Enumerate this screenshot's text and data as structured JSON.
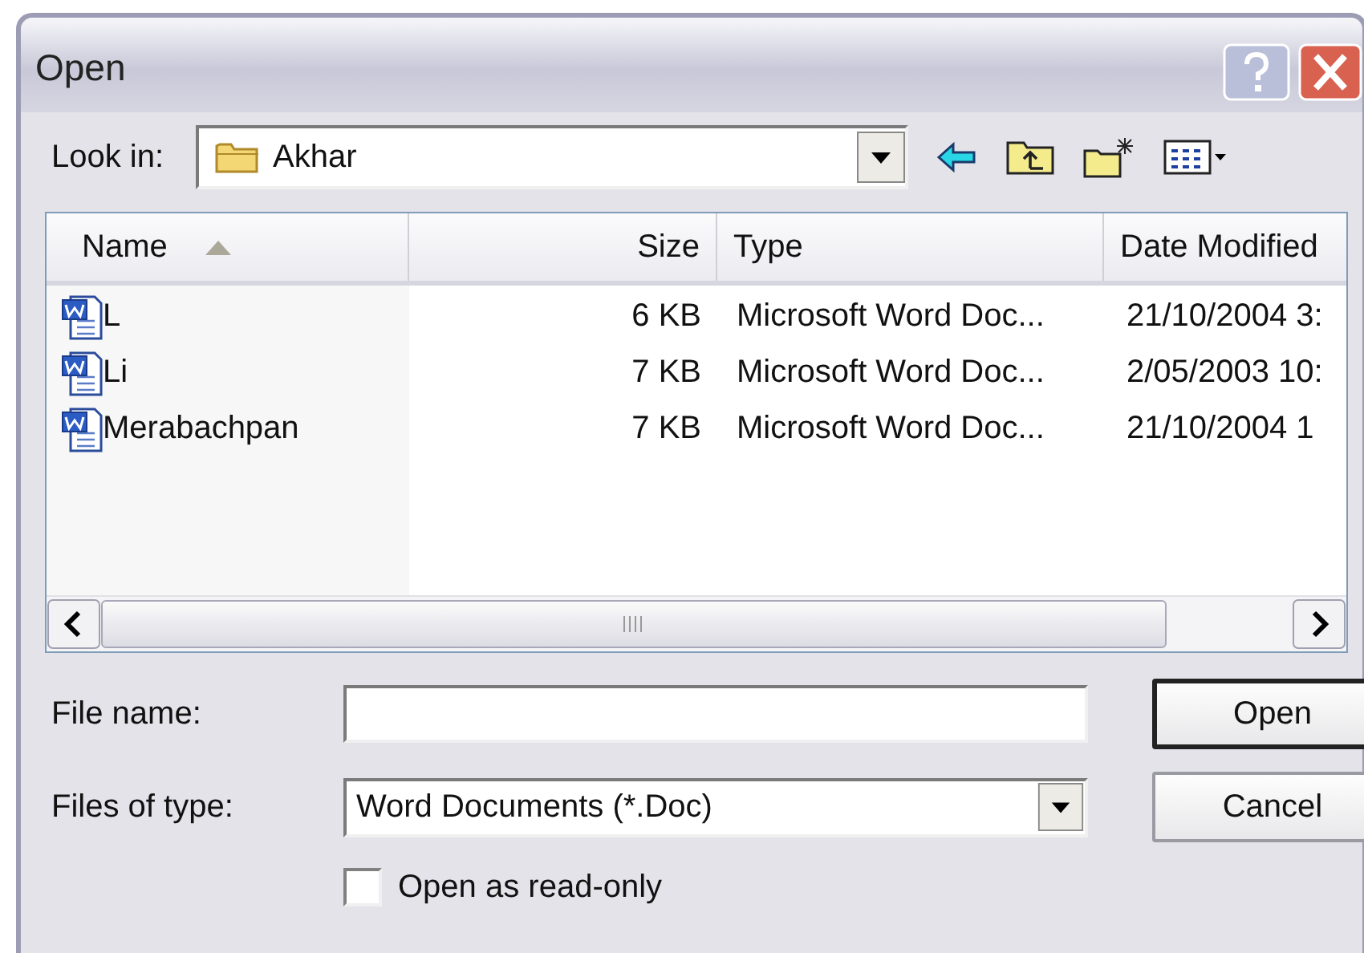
{
  "window": {
    "title": "Open"
  },
  "look_in": {
    "label": "Look in:",
    "value": "Akhar"
  },
  "file_list": {
    "columns": [
      {
        "label": "Name",
        "sorted": true
      },
      {
        "label": "Size",
        "sorted": false
      },
      {
        "label": "Type",
        "sorted": false
      },
      {
        "label": "Date Modified",
        "sorted": false
      }
    ],
    "rows": [
      {
        "name": "L",
        "size": "6 KB",
        "type": "Microsoft Word Doc...",
        "modified": "21/10/2004 3:"
      },
      {
        "name": "Li",
        "size": "7 KB",
        "type": "Microsoft Word Doc...",
        "modified": "2/05/2003 10:"
      },
      {
        "name": "Merabachpan",
        "size": "7 KB",
        "type": "Microsoft Word Doc...",
        "modified": "21/10/2004 1"
      }
    ]
  },
  "file_name": {
    "label": "File name:"
  },
  "files_of_type": {
    "label": "Files of type:",
    "value": "Word Documents (*.Doc)"
  },
  "read_only": {
    "label": "Open as read-only",
    "checked": false
  },
  "buttons": [
    {
      "label": "Open",
      "default": true
    },
    {
      "label": "Cancel",
      "default": false
    }
  ]
}
